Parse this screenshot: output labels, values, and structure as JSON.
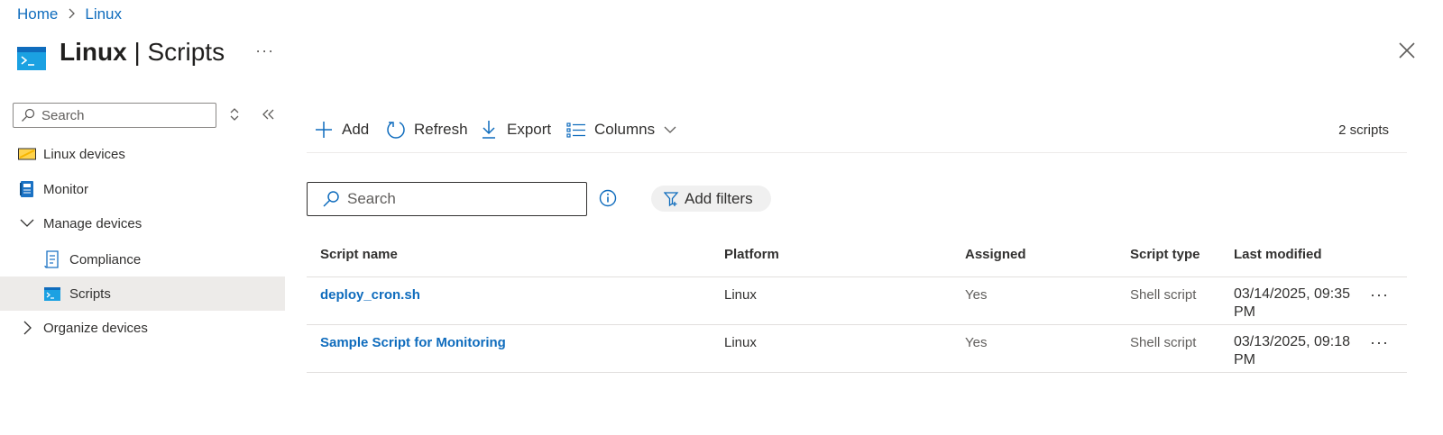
{
  "breadcrumb": {
    "home": "Home",
    "separator": ">",
    "current": "Linux"
  },
  "header": {
    "title_bold": "Linux",
    "title_rest": " | Scripts",
    "more": "···",
    "icon": "terminal-icon"
  },
  "sidebar": {
    "search_placeholder": "Search",
    "items": [
      {
        "label": "Linux devices",
        "icon": "linux-devices-icon"
      },
      {
        "label": "Monitor",
        "icon": "monitor-icon"
      },
      {
        "label": "Manage devices",
        "icon": "chevron-down-icon"
      },
      {
        "label": "Compliance",
        "icon": "compliance-icon"
      },
      {
        "label": "Scripts",
        "icon": "scripts-icon",
        "selected": true
      },
      {
        "label": "Organize devices",
        "icon": "chevron-right-icon"
      }
    ]
  },
  "toolbar": {
    "add": "Add",
    "refresh": "Refresh",
    "export": "Export",
    "columns": "Columns",
    "count": "2 scripts"
  },
  "filters": {
    "search_placeholder": "Search",
    "add_filters": "Add filters"
  },
  "table": {
    "headers": [
      "Script name",
      "Platform",
      "Assigned",
      "Script type",
      "Last modified"
    ],
    "rows": [
      {
        "name": "deploy_cron.sh",
        "platform": "Linux",
        "assigned": "Yes",
        "type": "Shell script",
        "modified": "03/14/2025, 09:35 PM",
        "more": "···"
      },
      {
        "name": "Sample Script for Monitoring",
        "platform": "Linux",
        "assigned": "Yes",
        "type": "Shell script",
        "modified": "03/13/2025, 09:18 PM",
        "more": "···"
      }
    ]
  },
  "colors": {
    "accent": "#0f6cbd",
    "selected_bg": "#edebe9",
    "text": "#323130"
  }
}
